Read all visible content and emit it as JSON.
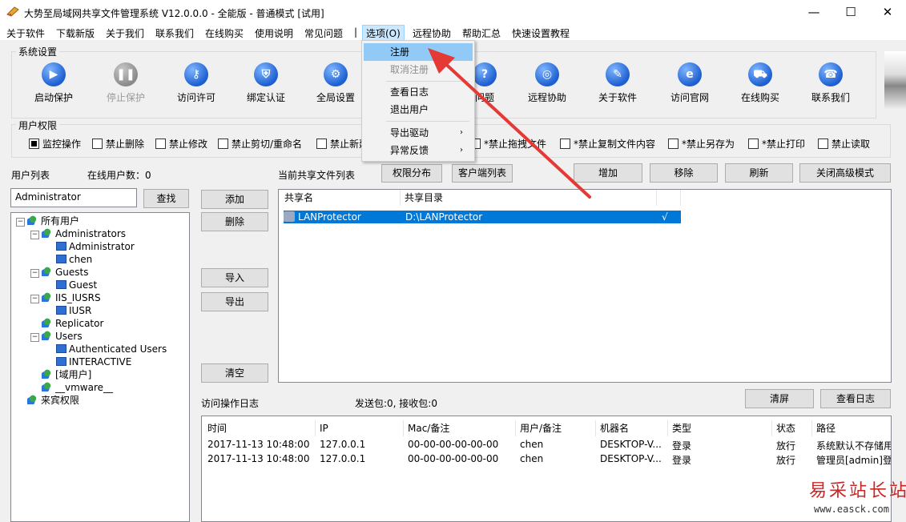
{
  "window": {
    "title": "大势至局域网共享文件管理系统 V12.0.0.0 - 全能版 - 普通模式 [试用]",
    "minimize": "—",
    "maximize": "☐",
    "close": "✕"
  },
  "menubar": {
    "items": [
      "关于软件",
      "下载新版",
      "关于我们",
      "联系我们",
      "在线购买",
      "使用说明",
      "常见问题",
      "|",
      "选项(O)",
      "远程协助",
      "帮助汇总",
      "快速设置教程"
    ]
  },
  "options_menu": {
    "items": [
      "注册",
      "取消注册",
      "查看日志",
      "退出用户",
      "导出驱动",
      "异常反馈"
    ],
    "arrow": "›"
  },
  "system_settings": {
    "label": "系统设置",
    "buttons": [
      "启动保护",
      "停止保护",
      "访问许可",
      "绑定认证",
      "全局设置",
      "问题",
      "远程协助",
      "关于软件",
      "访问官网",
      "在线购买",
      "联系我们"
    ]
  },
  "user_permissions": {
    "label": "用户权限",
    "checks": [
      "监控操作",
      "禁止删除",
      "禁止修改",
      "禁止剪切/重命名",
      "禁止新建",
      "*禁止拖拽文件",
      "*禁止复制文件内容",
      "*禁止另存为",
      "*禁止打印",
      "禁止读取"
    ]
  },
  "user_list": {
    "label": "用户列表",
    "online_count": "在线用户数：0",
    "search_value": "Administrator",
    "search_button": "查找",
    "tree": {
      "root": "所有用户",
      "administrators": "Administrators",
      "administrator": "Administrator",
      "chen": "chen",
      "guests": "Guests",
      "guest": "Guest",
      "iis_iusrs": "IIS_IUSRS",
      "iusr": "IUSR",
      "replicator": "Replicator",
      "users": "Users",
      "authenticated_users": "Authenticated Users",
      "interactive": "INTERACTIVE",
      "domain_users": "[域用户]",
      "vmware": "__vmware__",
      "guest_perm": "来宾权限"
    }
  },
  "middle_buttons": [
    "添加",
    "删除",
    "导入",
    "导出",
    "清空"
  ],
  "shared_files": {
    "label": "当前共享文件列表",
    "perm_dist": "权限分布",
    "client_list": "客户端列表",
    "add": "增加",
    "remove": "移除",
    "refresh": "刷新",
    "close_adv": "关闭高级模式",
    "columns": [
      "共享名",
      "共享目录"
    ],
    "rows": [
      {
        "name": "LANProtector",
        "path": "D:\\LANProtector",
        "check": "√"
      }
    ]
  },
  "access_log": {
    "label": "访问操作日志",
    "packets": "发送包:0, 接收包:0",
    "clear": "清屏",
    "view_log": "查看日志",
    "columns": [
      "时间",
      "IP",
      "Mac/备注",
      "用户/备注",
      "机器名",
      "类型",
      "状态",
      "路径"
    ],
    "rows": [
      [
        "2017-11-13 10:48:00",
        "127.0.0.1",
        "00-00-00-00-00-00",
        "chen",
        "DESKTOP-V...",
        "登录",
        "放行",
        "系统默认不存储用"
      ],
      [
        "2017-11-13 10:48:00",
        "127.0.0.1",
        "00-00-00-00-00-00",
        "chen",
        "DESKTOP-V...",
        "登录",
        "放行",
        "管理员[admin]登"
      ]
    ]
  },
  "watermark": {
    "line1": "易采站长站",
    "line2": "www.easck.com"
  }
}
